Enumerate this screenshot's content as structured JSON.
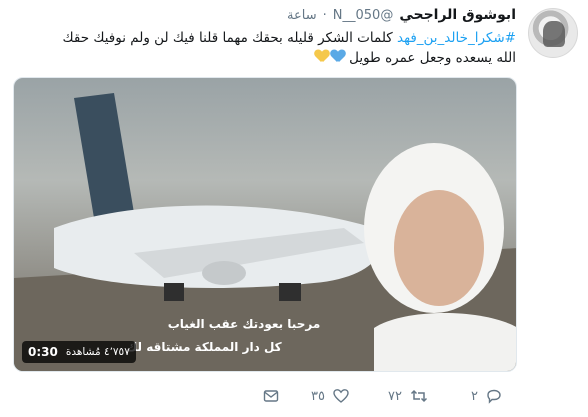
{
  "tweet": {
    "display_name": "ابوشوق الراجحي",
    "handle": "@N__050",
    "separator": "·",
    "timestamp": "ساعة",
    "text_line1_hashtag": "#شكرا_خالد_بن_فهد",
    "text_line1_rest": " كلمات الشكر قليله بحقك مهما قلنا فيك لن ولم نوفيك حقك",
    "text_line2": "الله يسعده وجعل عمره طويل",
    "hearts": [
      "blue-heart-icon",
      "yellow-heart-icon"
    ]
  },
  "media": {
    "type": "video",
    "duration": "0:30",
    "views": "٤٬٧٥٧ مُشاهدة",
    "overlay_text_1": "مرحبا بعودتك عقب الغياب",
    "overlay_text_2": "كل دار المملكة مشتاقه لك"
  },
  "actions": {
    "reply_count": "٢",
    "retweet_count": "٧٢",
    "like_count": "٣٥",
    "icons": [
      "reply-icon",
      "retweet-icon",
      "like-icon",
      "message-icon"
    ]
  },
  "colors": {
    "link": "#1da1f2",
    "secondary_text": "#657786",
    "retweet_active": "#17bf63"
  }
}
